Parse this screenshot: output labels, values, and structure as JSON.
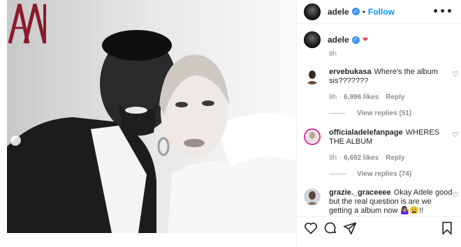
{
  "post": {
    "username": "adele",
    "follow_label": "Follow",
    "separator": "•",
    "more_label": "•••",
    "caption_heart": "❤",
    "caption_time": "8h"
  },
  "comments": [
    {
      "username": "ervebukasa",
      "text": "Where's the album sis???????",
      "time": "8h",
      "likes": "6,996 likes",
      "reply_label": "Reply",
      "view_replies": "View replies (51)"
    },
    {
      "username": "officialadelefanpage",
      "text": "WHERES THE ALBUM",
      "time": "8h",
      "likes": "6,692 likes",
      "reply_label": "Reply",
      "view_replies": "View replies (74)"
    },
    {
      "username": "grazie._graceeee",
      "text": "Okay Adele good but the real question is are we getting a album now 🤷🏽‍♀️😩!!"
    }
  ],
  "icons": {
    "verified": "verified-badge-icon",
    "like": "heart-icon",
    "comment": "comment-bubble-icon",
    "share": "paper-plane-icon",
    "save": "bookmark-icon",
    "photo_logo": "magazine-logo"
  },
  "colors": {
    "accent": "#0095f6",
    "verified": "#3897f0",
    "heart": "#ed4956",
    "logo": "#8b1a2b"
  }
}
